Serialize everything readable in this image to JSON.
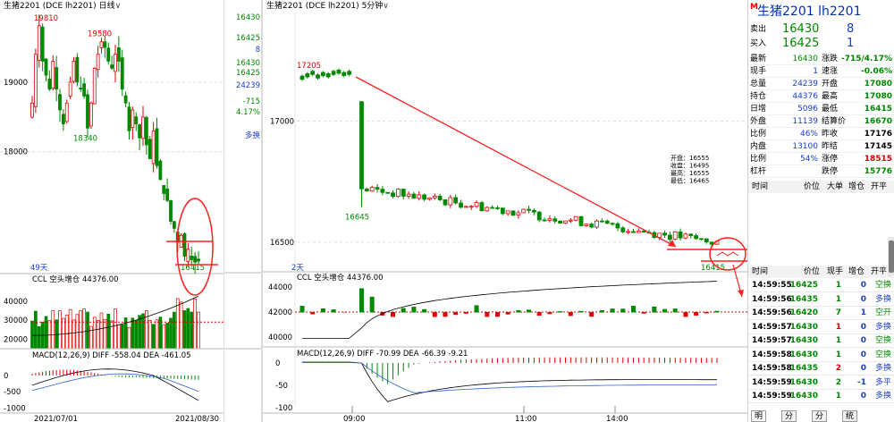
{
  "left_chart": {
    "header": {
      "title": "生猪2201",
      "code": "(DCE lh2201)",
      "period": "日线"
    },
    "high_labels": [
      "19810",
      "19580",
      "18340"
    ],
    "y_labels": [
      "19000",
      "18000"
    ],
    "period_count": "49天",
    "last_label": "16415",
    "x_labels": [
      "2021/07/01",
      "2021/08/30"
    ],
    "ccl": {
      "label": "CCL",
      "mode": "空头增仓",
      "value": "44376.00",
      "ticks": [
        "40000",
        "30000",
        "20000"
      ]
    },
    "macd": {
      "label": "MACD(12,26,9)",
      "diff": "DIFF -558.04",
      "dea": "DEA -461.05",
      "ticks": [
        "0",
        "-500",
        "-1000"
      ]
    }
  },
  "mini_panel": {
    "values": [
      "16430",
      "16425",
      "8",
      "1",
      "16430",
      "16425",
      "24239",
      "-715",
      "4.17%"
    ],
    "bottom": "多换"
  },
  "mid_chart": {
    "header": {
      "title": "生猪2201",
      "code": "(DCE lh2201)",
      "period": "5分钟"
    },
    "high_label": "17205",
    "low_label": "16645",
    "last_label": "16415",
    "y_labels": [
      "17000",
      "16500"
    ],
    "period_count": "2天",
    "tooltip": {
      "open": "开盘：16555",
      "close": "收盘：16495",
      "high": "最高：16555",
      "low": "最低：16465"
    },
    "x_labels": [
      "09:00",
      "11:00",
      "14:00"
    ],
    "ccl": {
      "label": "CCL",
      "mode": "空头增仓",
      "value": "44376.00",
      "ticks": [
        "44000",
        "42000",
        "40000"
      ]
    },
    "macd": {
      "label": "MACD(12,26,9)",
      "diff": "DIFF -70.99",
      "dea": "DEA -66.39",
      "extra": "-9.21",
      "ticks": [
        "0",
        "-50",
        "-100"
      ]
    }
  },
  "quote": {
    "logo": "M",
    "title": "生猪2201 lh2201",
    "sell": {
      "label": "卖出",
      "price": "16430",
      "vol": "8"
    },
    "buy": {
      "label": "买入",
      "price": "16425",
      "vol": "1"
    },
    "rows": [
      {
        "l1": "最新",
        "v1": "16430",
        "c1": "green",
        "l2": "涨跌",
        "v2": "-715/4.17%",
        "c2": "green"
      },
      {
        "l1": "现手",
        "v1": "1",
        "c1": "blue",
        "l2": "速涨",
        "v2": "-0.06%",
        "c2": "green"
      },
      {
        "l1": "总量",
        "v1": "24239",
        "c1": "blue",
        "l2": "开盘",
        "v2": "17080",
        "c2": "green"
      },
      {
        "l1": "持仓",
        "v1": "44376",
        "c1": "blue",
        "l2": "最高",
        "v2": "17080",
        "c2": "green"
      },
      {
        "l1": "日增",
        "v1": "5096",
        "c1": "blue",
        "l2": "最低",
        "v2": "16415",
        "c2": "green"
      },
      {
        "l1": "外盘",
        "v1": "11139",
        "c1": "blue",
        "l2": "结算价",
        "v2": "16670",
        "c2": "green"
      },
      {
        "l1": "比例",
        "v1": "46%",
        "c1": "blue",
        "l2": "昨收",
        "v2": "17176",
        "c2": "black"
      },
      {
        "l1": "内盘",
        "v1": "13100",
        "c1": "blue",
        "l2": "昨结",
        "v2": "17145",
        "c2": "black"
      },
      {
        "l1": "比例",
        "v1": "54%",
        "c1": "blue",
        "l2": "涨停",
        "v2": "18515",
        "c2": "red"
      },
      {
        "l1": "杠杆",
        "v1": "",
        "c1": "blue",
        "l2": "跌停",
        "v2": "15776",
        "c2": "green"
      }
    ],
    "top_table_header": [
      "时间",
      "价位",
      "大单",
      "增仓",
      "开平"
    ],
    "tick_header": [
      "时间",
      "价位",
      "现手",
      "增仓",
      "开平"
    ],
    "ticks": [
      {
        "t": "14:59:55",
        "p": "16425",
        "pc": "green",
        "v": "1",
        "vc": "green",
        "z": "0",
        "k": "空换",
        "kc": "green"
      },
      {
        "t": "14:59:56",
        "p": "16435",
        "pc": "green",
        "v": "1",
        "vc": "green",
        "z": "0",
        "k": "多换",
        "kc": "blue"
      },
      {
        "t": "14:59:56",
        "p": "16420",
        "pc": "green",
        "v": "7",
        "vc": "green",
        "z": "1",
        "k": "空开",
        "kc": "green"
      },
      {
        "t": "14:59:57",
        "p": "16430",
        "pc": "green",
        "v": "1",
        "vc": "red",
        "z": "0",
        "k": "多换",
        "kc": "blue"
      },
      {
        "t": "14:59:57",
        "p": "16430",
        "pc": "green",
        "v": "1",
        "vc": "green",
        "z": "0",
        "k": "空换",
        "kc": "green"
      },
      {
        "t": "14:59:58",
        "p": "16430",
        "pc": "green",
        "v": "1",
        "vc": "green",
        "z": "0",
        "k": "空换",
        "kc": "green"
      },
      {
        "t": "14:59:58",
        "p": "16435",
        "pc": "green",
        "v": "2",
        "vc": "red",
        "z": "0",
        "k": "多换",
        "kc": "blue"
      },
      {
        "t": "14:59:59",
        "p": "16430",
        "pc": "green",
        "v": "2",
        "vc": "green",
        "z": "-1",
        "k": "多平",
        "kc": "blue"
      },
      {
        "t": "14:59:59",
        "p": "16430",
        "pc": "green",
        "v": "1",
        "vc": "green",
        "z": "0",
        "k": "多换",
        "kc": "blue"
      }
    ],
    "tabs": [
      "明细",
      "分价",
      "分笔",
      "统计"
    ]
  },
  "colors": {
    "up": "#e00000",
    "down": "#008800",
    "annotation": "#ff2020",
    "diff": "#000000",
    "dea": "#3060d0"
  }
}
